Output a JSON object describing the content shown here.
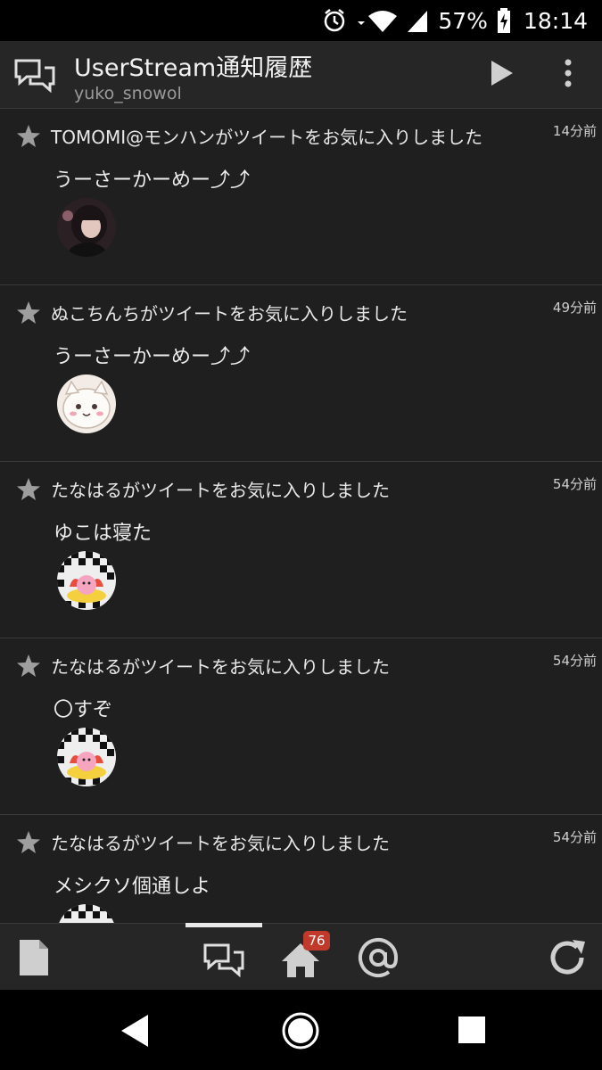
{
  "status_bar": {
    "battery": "57%",
    "time": "18:14"
  },
  "app_bar": {
    "title": "UserStream通知履歴",
    "subtitle": "yuko_snowol"
  },
  "notifications": [
    {
      "text": "TOMOMI@モンハンがツイートをお気に入りしました",
      "time": "14分前",
      "tweet": "うーさーかーめー⤴⤴",
      "avatar": "avatar-photo"
    },
    {
      "text": "ぬこちんちがツイートをお気に入りしました",
      "time": "49分前",
      "tweet": "うーさーかーめー⤴⤴",
      "avatar": "avatar-cat"
    },
    {
      "text": "たなはるがツイートをお気に入りしました",
      "time": "54分前",
      "tweet": "ゆこは寝た",
      "avatar": "avatar-kirby"
    },
    {
      "text": "たなはるがツイートをお気に入りしました",
      "time": "54分前",
      "tweet": "〇すぞ",
      "avatar": "avatar-kirby"
    },
    {
      "text": "たなはるがツイートをお気に入りしました",
      "time": "54分前",
      "tweet": "メシクソ個通しよ",
      "avatar": "avatar-kirby"
    }
  ],
  "bottom_nav": {
    "home_badge": "76",
    "icons": [
      "document-icon",
      "conversation-icon",
      "home-icon",
      "mention-icon",
      "refresh-icon"
    ]
  },
  "colors": {
    "background": "#1f1f1f",
    "bar": "#262626",
    "badge": "#c0392b"
  }
}
